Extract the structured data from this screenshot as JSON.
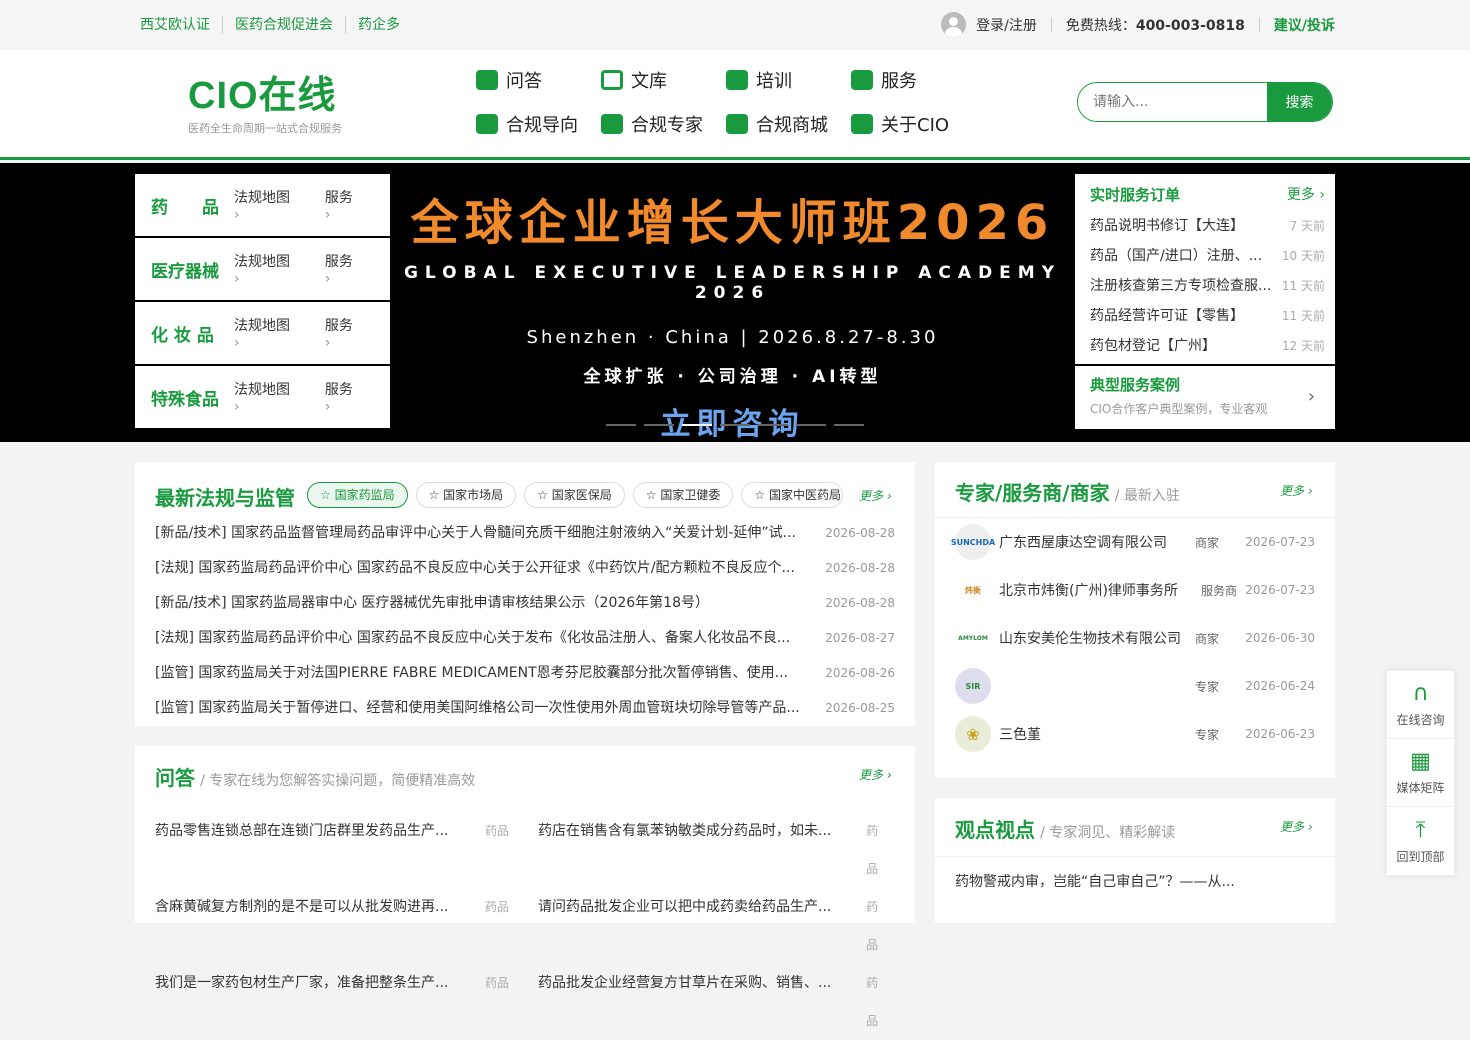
{
  "topbar": {
    "links": [
      "西艾欧认证",
      "医药合规促进会",
      "药企多"
    ],
    "login": "登录/注册",
    "hotline_label": "免费热线：",
    "hotline_number": "400-003-0818",
    "feedback": "建议/投诉"
  },
  "header": {
    "logo_text": "CIO在线",
    "logo_sub": "医药全生命周期一站式合规服务",
    "nav": [
      {
        "label": "问答",
        "icon": "qa-icon"
      },
      {
        "label": "文库",
        "icon": "library-icon"
      },
      {
        "label": "培训",
        "icon": "training-icon"
      },
      {
        "label": "服务",
        "icon": "service-icon"
      },
      {
        "label": "合规导向",
        "icon": "guide-icon"
      },
      {
        "label": "合规专家",
        "icon": "expert-icon"
      },
      {
        "label": "合规商城",
        "icon": "cart-icon"
      },
      {
        "label": "关于CIO",
        "icon": "about-icon"
      }
    ],
    "search_placeholder": "请输入...",
    "search_button": "搜索"
  },
  "banner": {
    "categories": [
      {
        "name": "药　　品",
        "map": "法规地图",
        "service": "服务"
      },
      {
        "name": "医疗器械",
        "map": "法规地图",
        "service": "服务"
      },
      {
        "name": "化 妆 品",
        "map": "法规地图",
        "service": "服务"
      },
      {
        "name": "特殊食品",
        "map": "法规地图",
        "service": "服务"
      }
    ],
    "hero_title": "全球企业增长大师班2026",
    "hero_en": "GLOBAL EXECUTIVE LEADERSHIP ACADEMY 2026",
    "hero_place": "Shenzhen · China | 2026.8.27-8.30",
    "hero_tags": "全球扩张 · 公司治理 · AI转型",
    "hero_cta": "立即咨询",
    "orders_title": "实时服务订单",
    "orders_more": "更多 ›",
    "orders": [
      {
        "title": "药品说明书修订【大连】",
        "time": "7 天前"
      },
      {
        "title": "药品（国产/进口）注册、...",
        "time": "10 天前"
      },
      {
        "title": "注册核查第三方专项检查服...",
        "time": "11 天前"
      },
      {
        "title": "药品经营许可证【零售】",
        "time": "11 天前"
      },
      {
        "title": "药包材登记【广州】",
        "time": "12 天前"
      }
    ],
    "cases_title": "典型服务案例",
    "cases_sub": "CIO合作客户典型案例，专业客观"
  },
  "news": {
    "title": "最新法规与监管",
    "tabs": [
      "国家药监局",
      "国家市场局",
      "国家医保局",
      "国家卫健委",
      "国家中医药局"
    ],
    "more": "更多 ›",
    "items": [
      {
        "text": "[新品/技术] 国家药品监督管理局药品审评中心关于人骨髓间充质干细胞注射液纳入“关爱计划-延伸”试...",
        "date": "2026-08-28"
      },
      {
        "text": "[法规] 国家药监局药品评价中心 国家药品不良反应中心关于公开征求《中药饮片/配方颗粒不良反应个...",
        "date": "2026-08-28"
      },
      {
        "text": "[新品/技术] 国家药监局器审中心 医疗器械优先审批申请审核结果公示（2026年第18号）",
        "date": "2026-08-28"
      },
      {
        "text": "[法规] 国家药监局药品评价中心 国家药品不良反应中心关于发布《化妆品注册人、备案人化妆品不良...",
        "date": "2026-08-27"
      },
      {
        "text": "[监管] 国家药监局关于对法国PIERRE FABRE MEDICAMENT恩考芬尼胶囊部分批次暂停销售、使用...",
        "date": "2026-08-26"
      },
      {
        "text": "[监管] 国家药监局关于暂停进口、经营和使用美国阿维格公司一次性使用外周血管斑块切除导管等产品...",
        "date": "2026-08-25"
      }
    ]
  },
  "experts": {
    "title": "专家/服务商/商家",
    "sub": "/ 最新入驻",
    "more": "更多 ›",
    "items": [
      {
        "logo": "SUNCHDA",
        "name": "广东西屋康达空调有限公司",
        "type": "商家",
        "date": "2026-07-23"
      },
      {
        "logo": "炜衡",
        "name": "北京市炜衡(广州)律师事务所",
        "type": "服务商",
        "date": "2026-07-23"
      },
      {
        "logo": "AMYLOM",
        "name": "山东安美伦生物技术有限公司",
        "type": "商家",
        "date": "2026-06-30"
      },
      {
        "logo": "SIR",
        "name": "",
        "type": "专家",
        "date": "2026-06-24"
      },
      {
        "logo": "❀",
        "name": "三色堇",
        "type": "专家",
        "date": "2026-06-23"
      }
    ]
  },
  "qa": {
    "title": "问答",
    "sub": "/ 专家在线为您解答实操问题，简便精准高效",
    "more": "更多 ›",
    "items": [
      {
        "q": "药品零售连锁总部在连锁门店群里发药品生产...",
        "c": "药品"
      },
      {
        "q": "药店在销售含有氯苯钠敏类成分药品时，如未...",
        "c": "药品"
      },
      {
        "q": "含麻黄碱复方制剂的是不是可以从批发购进再...",
        "c": "药品"
      },
      {
        "q": "请问药品批发企业可以把中成药卖给药品生产...",
        "c": "药品"
      },
      {
        "q": "我们是一家药包材生产厂家，准备把整条生产...",
        "c": "药品"
      },
      {
        "q": "药品批发企业经营复方甘草片在采购、销售、...",
        "c": "药品"
      }
    ]
  },
  "views": {
    "title": "观点视点",
    "sub": "/ 专家洞见、精彩解读",
    "more": "更多 ›",
    "items": [
      "药物警戒内审，岂能“自己审自己”？——从..."
    ]
  },
  "float": [
    {
      "label": "在线咨询",
      "icon": "headset-icon"
    },
    {
      "label": "媒体矩阵",
      "icon": "qrcode-icon"
    },
    {
      "label": "回到顶部",
      "icon": "back-to-top-icon"
    }
  ]
}
